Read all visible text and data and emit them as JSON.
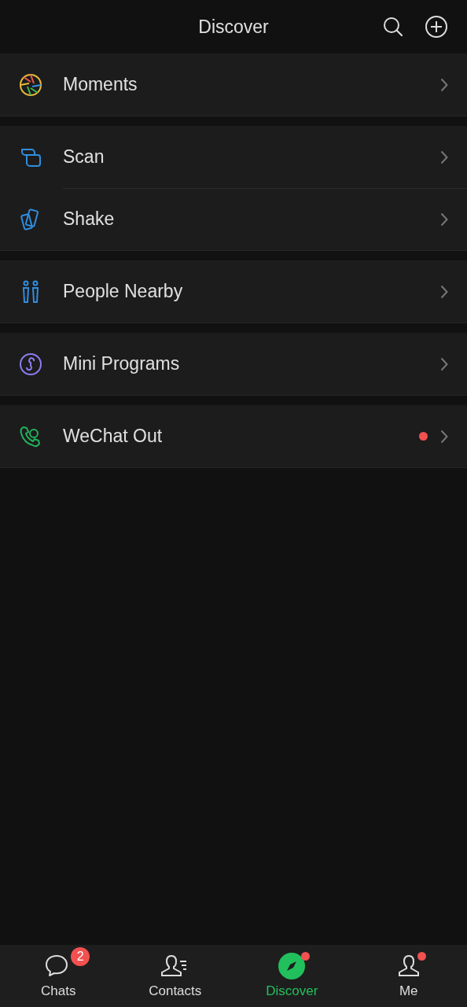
{
  "header": {
    "title": "Discover"
  },
  "groups": [
    {
      "items": [
        {
          "kind": "moments",
          "label": "Moments",
          "dot": false
        }
      ]
    },
    {
      "items": [
        {
          "kind": "scan",
          "label": "Scan",
          "dot": false
        },
        {
          "kind": "shake",
          "label": "Shake",
          "dot": false
        }
      ]
    },
    {
      "items": [
        {
          "kind": "people",
          "label": "People Nearby",
          "dot": false
        }
      ]
    },
    {
      "items": [
        {
          "kind": "mini",
          "label": "Mini Programs",
          "dot": false
        }
      ]
    },
    {
      "items": [
        {
          "kind": "phone",
          "label": "WeChat Out",
          "dot": true
        }
      ]
    }
  ],
  "tabs": [
    {
      "kind": "chats",
      "label": "Chats",
      "selected": false,
      "badge": "2",
      "dot": false
    },
    {
      "kind": "contacts",
      "label": "Contacts",
      "selected": false,
      "dot": false
    },
    {
      "kind": "discover",
      "label": "Discover",
      "selected": true,
      "dot": true
    },
    {
      "kind": "me",
      "label": "Me",
      "selected": false,
      "dot": true
    }
  ]
}
